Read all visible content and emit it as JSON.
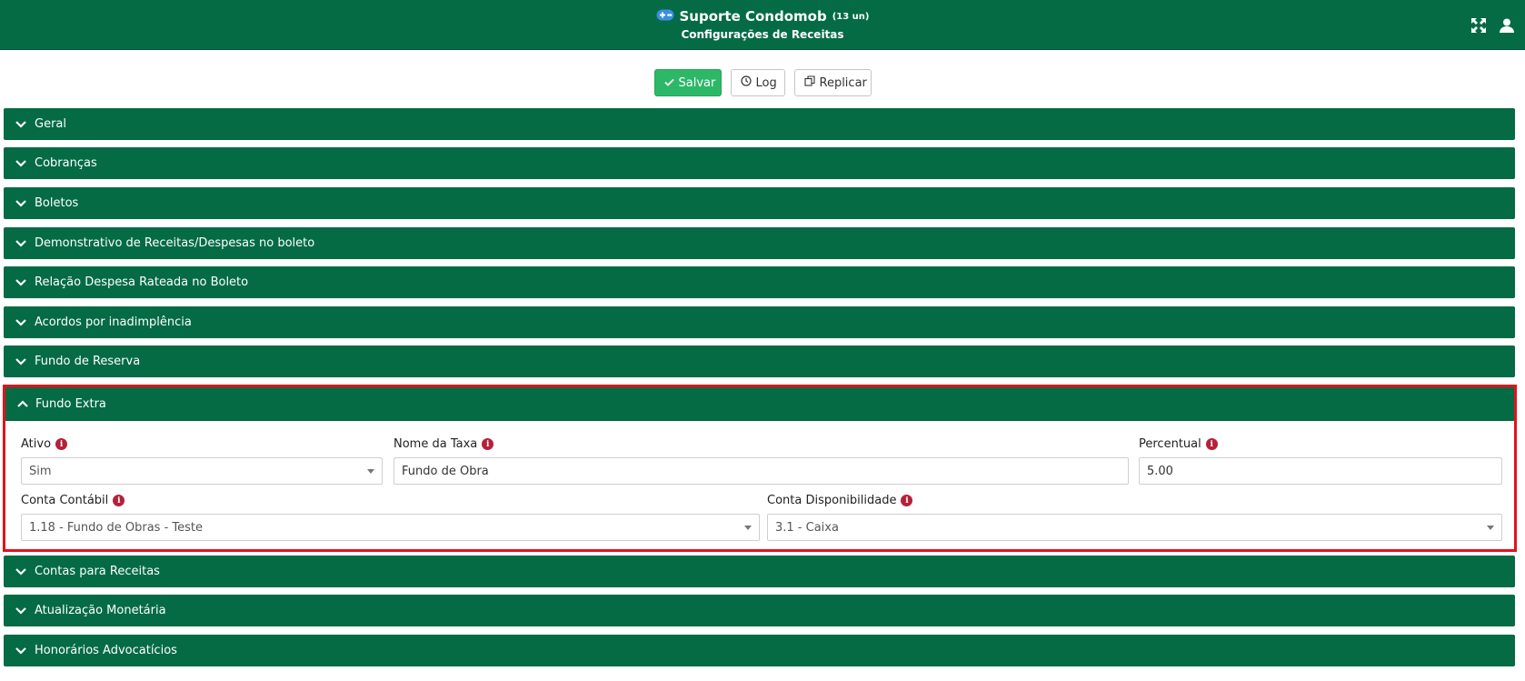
{
  "header": {
    "app_title": "Suporte Condomob",
    "units": "(13 un)",
    "subtitle": "Configurações de Receitas"
  },
  "toolbar": {
    "save_label": "Salvar",
    "log_label": "Log",
    "replicate_label": "Replicar"
  },
  "sections_top": [
    "Geral",
    "Cobranças",
    "Boletos",
    "Demonstrativo de Receitas/Despesas no boleto",
    "Relação Despesa Rateada no Boleto",
    "Acordos por inadimplência",
    "Fundo de Reserva"
  ],
  "open_section": {
    "title": "Fundo Extra",
    "fields": {
      "ativo": {
        "label": "Ativo",
        "value": "Sim"
      },
      "nome_taxa": {
        "label": "Nome da Taxa",
        "value": "Fundo de Obra"
      },
      "percentual": {
        "label": "Percentual",
        "value": "5.00"
      },
      "conta_contabil": {
        "label": "Conta Contábil",
        "value": "1.18 - Fundo de Obras - Teste"
      },
      "conta_disponibilidade": {
        "label": "Conta Disponibilidade",
        "value": "3.1 - Caixa"
      }
    }
  },
  "sections_bottom": [
    "Contas para Receitas",
    "Atualização Monetária",
    "Honorários Advocatícios"
  ],
  "colors": {
    "brand_green": "#046b45",
    "save_green": "#2db868",
    "highlight_red": "#e3121b",
    "info_red": "#b5213a"
  }
}
